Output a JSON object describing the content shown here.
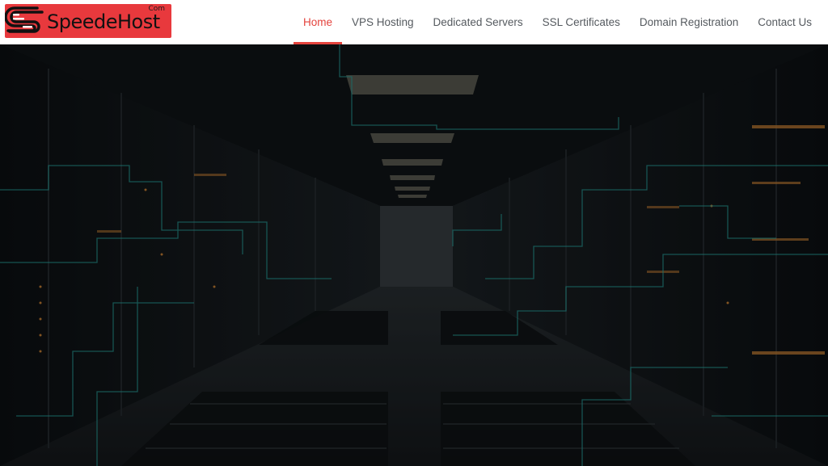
{
  "brand": {
    "name": "SpeedeHost",
    "suffix": "Com",
    "colors": {
      "primary": "#e8393d",
      "nav_active": "#e4433d",
      "nav_text": "#555a5f"
    }
  },
  "nav": {
    "items": [
      {
        "label": "Home",
        "active": true
      },
      {
        "label": "VPS Hosting",
        "active": false
      },
      {
        "label": "Dedicated Servers",
        "active": false
      },
      {
        "label": "SSL Certificates",
        "active": false
      },
      {
        "label": "Domain Registration",
        "active": false
      },
      {
        "label": "Contact Us",
        "active": false
      }
    ]
  },
  "hero": {
    "image": "data-center-server-corridor"
  }
}
